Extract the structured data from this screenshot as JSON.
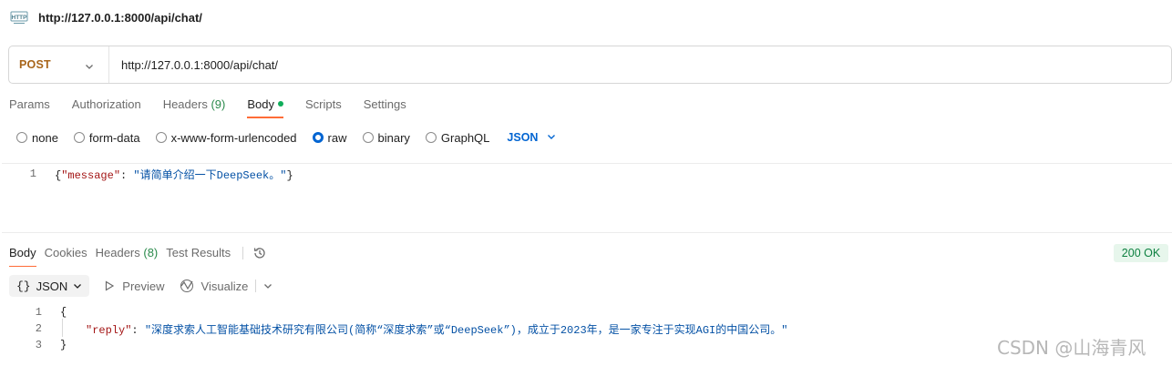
{
  "window": {
    "title": "http://127.0.0.1:8000/api/chat/",
    "icon": "http-icon"
  },
  "request": {
    "method": "POST",
    "url": "http://127.0.0.1:8000/api/chat/"
  },
  "request_tabs": {
    "params": "Params",
    "authorization": "Authorization",
    "headers": "Headers",
    "headers_count": "(9)",
    "body": "Body",
    "scripts": "Scripts",
    "settings": "Settings",
    "active": "Body"
  },
  "body_types": {
    "none": "none",
    "form_data": "form-data",
    "urlencoded": "x-www-form-urlencoded",
    "raw": "raw",
    "binary": "binary",
    "graphql": "GraphQL",
    "selected": "raw",
    "format": "JSON"
  },
  "request_body": {
    "line_number": "1",
    "key": "\"message\"",
    "value": "\"请简单介绍一下DeepSeek。\""
  },
  "response_tabs": {
    "body": "Body",
    "cookies": "Cookies",
    "headers": "Headers",
    "headers_count": "(8)",
    "test_results": "Test Results",
    "active": "Body"
  },
  "response": {
    "status": "200 OK",
    "status_color": "#0d8040"
  },
  "response_toolbar": {
    "braces": "{}",
    "format": "JSON",
    "preview": "Preview",
    "visualize": "Visualize"
  },
  "response_body": {
    "lines": [
      "1",
      "2",
      "3"
    ],
    "open_brace": "{",
    "close_brace": "}",
    "key": "\"reply\"",
    "value": "\"深度求索人工智能基础技术研究有限公司(简称“深度求索”或“DeepSeek”)，成立于2023年，是一家专注于实现AGI的中国公司。\""
  },
  "watermark": "CSDN @山海青风",
  "colors": {
    "accent_orange": "#ff6c37",
    "method_post": "#a8651a",
    "link_blue": "#0265d2",
    "json_key": "#a31515",
    "json_string": "#0451a5"
  }
}
